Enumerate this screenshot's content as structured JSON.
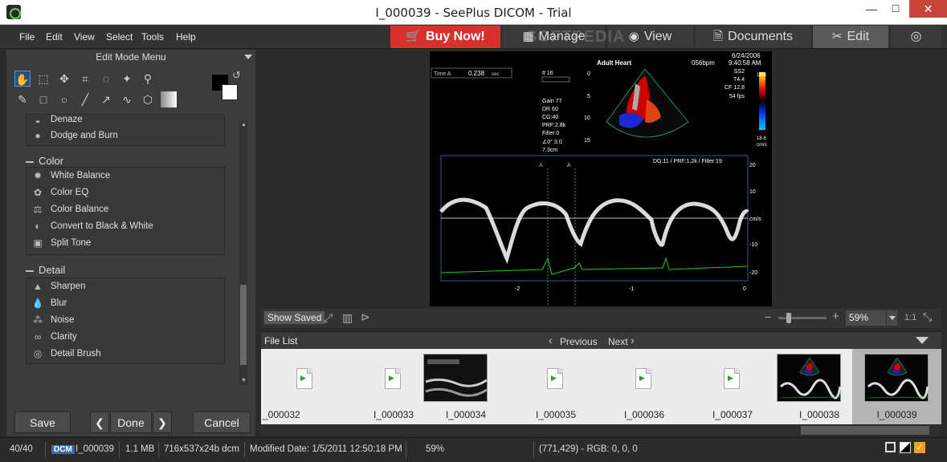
{
  "window": {
    "title": "I_000039 - SeePlus DICOM - Trial",
    "minimize": "—",
    "maximize": "☐",
    "close": "✕"
  },
  "menu": [
    "File",
    "Edit",
    "View",
    "Select",
    "Tools",
    "Help"
  ],
  "tabs": {
    "buy_now": "Buy Now!",
    "manage": "Manage",
    "view": "View",
    "documents": "Documents",
    "edit": "Edit"
  },
  "watermark": "SOFTPEDIA",
  "left_panel": {
    "header": "Edit Mode Menu",
    "partial_item": "Denaze",
    "top_items": [
      "Dodge and Burn"
    ],
    "color_header": "Color",
    "color_items": [
      "White Balance",
      "Color EQ",
      "Color Balance",
      "Convert to Black & White",
      "Split Tone"
    ],
    "detail_header": "Detail",
    "detail_items": [
      "Sharpen",
      "Blur",
      "Noise",
      "Clarity",
      "Detail Brush"
    ],
    "save": "Save",
    "done": "Done",
    "cancel": "Cancel"
  },
  "ultrasound": {
    "date": "6/24/2006",
    "title": "Adult Heart",
    "bpm": "056bpm",
    "time": "9:40:58 AM",
    "time_label": "Time A",
    "time_value": "0.238",
    "time_unit": "sec",
    "params_right": [
      "SS2",
      "T4.4",
      "CF 12.8",
      "54 fps"
    ],
    "params_left": [
      "Gain 77",
      "DR 60",
      "CG:40",
      "PRF:2.8k",
      "Filter:0",
      "∠0°  3.0",
      "7.3cm"
    ],
    "depth_ticks": [
      "0",
      "5",
      "10",
      "15"
    ],
    "colorbar_top": "18.6",
    "colorbar_bottom": "18.6",
    "colorbar_unit": "cm/s",
    "doppler_header": "DG:11 /  PRF:1.2k / Filter:19",
    "doppler_yticks": [
      "20",
      "10",
      "cm/s",
      "-10",
      "-20"
    ],
    "doppler_xticks": [
      "-2",
      "-1",
      "0"
    ],
    "marker_a1": "A",
    "marker_a2": "A",
    "frame_label": "# 16"
  },
  "view_toolbar": {
    "show_saved": "Show Saved",
    "zoom": "59%",
    "ratio": "1:1"
  },
  "file_list": {
    "label": "File List",
    "previous": "Previous",
    "next": "Next"
  },
  "thumbnails": [
    {
      "label": "_000032",
      "type": "file"
    },
    {
      "label": "I_000033",
      "type": "file"
    },
    {
      "label": "I_000034",
      "type": "image"
    },
    {
      "label": "I_000035",
      "type": "file"
    },
    {
      "label": "I_000036",
      "type": "file"
    },
    {
      "label": "I_000037",
      "type": "file"
    },
    {
      "label": "I_000038",
      "type": "image"
    },
    {
      "label": "I_000039",
      "type": "image",
      "selected": true
    }
  ],
  "status": {
    "count": "40/40",
    "format": "DCM",
    "filename": "I_000039",
    "size": "1.1 MB",
    "dims": "716x537x24b dcm",
    "modified": "Modified Date: 1/5/2011 12:50:18 PM",
    "zoom": "59%",
    "pixel": "(771,429) - RGB: 0, 0, 0"
  }
}
